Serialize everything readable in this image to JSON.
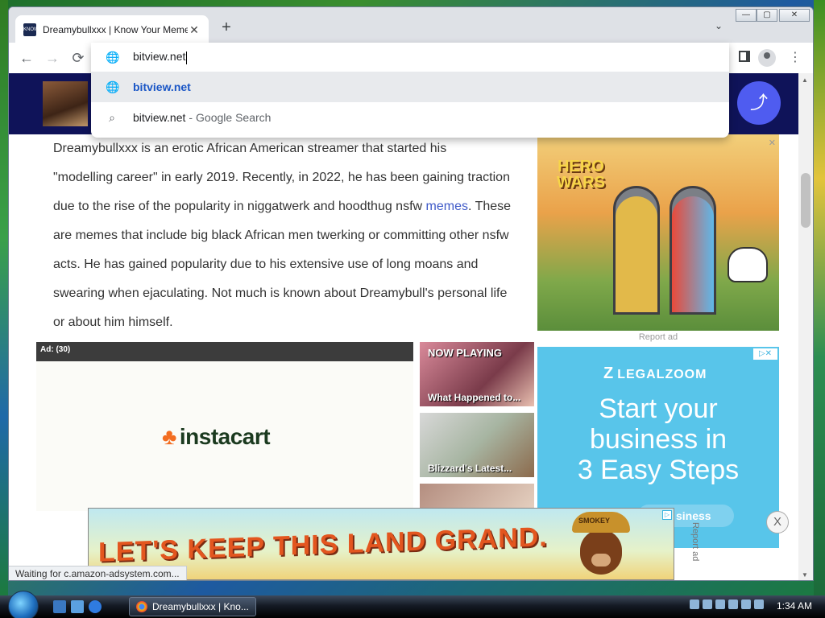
{
  "browser": {
    "tab_title": "Dreamybullxxx | Know Your Meme",
    "tab_close": "✕",
    "new_tab": "+",
    "tab_menu": "⌄",
    "favicon_text": "KNOW YOUR MEME",
    "nav": {
      "back": "←",
      "forward": "→",
      "reload": "⟳"
    },
    "kebab": "⋮",
    "window_controls": {
      "min": "—",
      "max": "▢",
      "close": "✕"
    }
  },
  "omnibox": {
    "typed": "bitview.net",
    "suggestions": [
      {
        "main": "bitview.net",
        "icon": "globe-icon"
      },
      {
        "main": "bitview.net",
        "sep": "-",
        "sub": "Google Search",
        "icon": "search-icon"
      }
    ]
  },
  "page": {
    "share_icon": "share-icon",
    "article": {
      "line_partial": "Dreamybullxxx is an erotic African American streamer that started his",
      "text_a": "\"modelling career\" in early 2019. Recently, in 2022, he has been gaining traction due to the rise of the popularity in niggatwerk and hoodthug nsfw ",
      "link": "memes",
      "text_b": ". These are memes that include big black African men twerking or committing other nsfw acts. He has gained popularity due to his extensive use of long moans and swearing when ejaculating. Not much is known about Dreamybull's personal life or about him himself."
    },
    "hero_ad": {
      "logo": "HERO WARS",
      "report": "Report ad",
      "close": "✕"
    },
    "video": {
      "label": "Ad: (30)",
      "brand": "instacart",
      "carrot": "♣"
    },
    "thumbs": [
      {
        "top_label": "NOW PLAYING",
        "caption": "What Happened to..."
      },
      {
        "top_label": "",
        "caption": "Blizzard's Latest..."
      },
      {
        "top_label": "",
        "caption": ""
      }
    ],
    "legal_ad": {
      "brand": "LEGALZOOM",
      "brand_mark": "Z",
      "headline_1": "Start your",
      "headline_2": "business in",
      "headline_3": "3 Easy Steps",
      "choice": "▷✕",
      "pill": "siness"
    },
    "bottom_ad": {
      "headline": "LET'S KEEP THIS LAND GRAND.",
      "hat_text": "SMOKEY",
      "report": "Report ad",
      "close": "X",
      "choice": "▷"
    },
    "status": "Waiting for c.amazon-adsystem.com..."
  },
  "taskbar": {
    "task_label": "Dreamybullxxx | Kno...",
    "clock": "1:34 AM"
  },
  "colors": {
    "header_navy": "#0f1359",
    "share_blue": "#4f5cf0",
    "link_blue": "#3f5ac8",
    "legalzoom_blue": "#58c5ea"
  }
}
